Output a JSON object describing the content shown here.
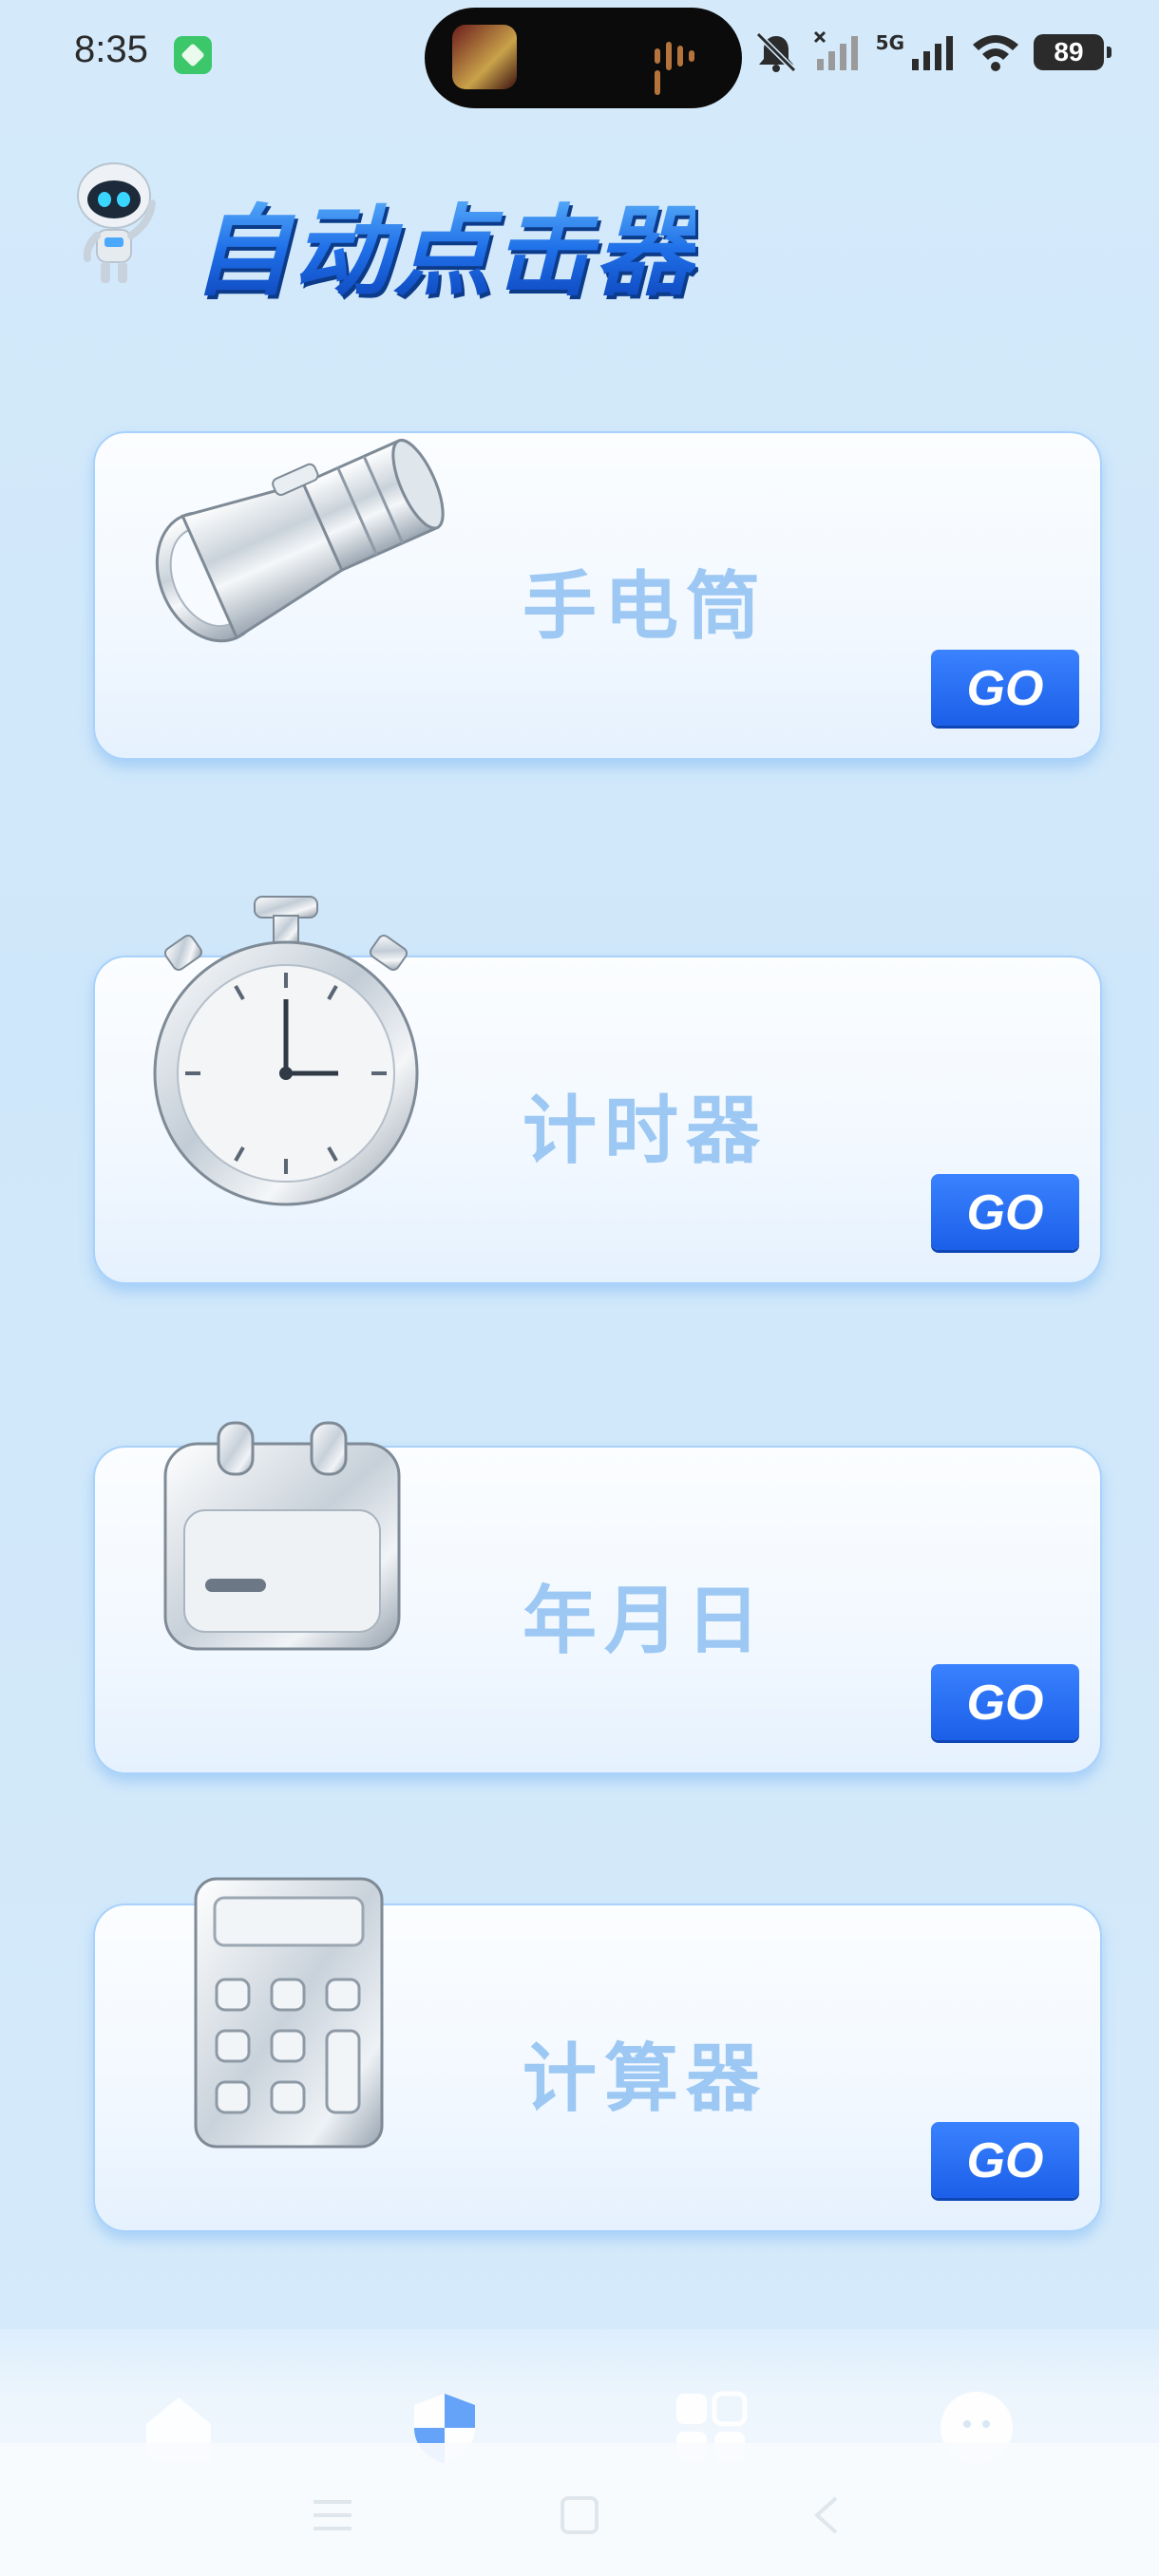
{
  "status_bar": {
    "time": "8:35",
    "network_label": "5G",
    "battery": "89"
  },
  "header": {
    "app_title": "自动点击器"
  },
  "cards": [
    {
      "title": "手电筒",
      "go_label": "GO",
      "icon": "flashlight-icon"
    },
    {
      "title": "计时器",
      "go_label": "GO",
      "icon": "stopwatch-icon"
    },
    {
      "title": "年月日",
      "go_label": "GO",
      "icon": "calendar-icon"
    },
    {
      "title": "计算器",
      "go_label": "GO",
      "icon": "calculator-icon"
    }
  ],
  "bottom_nav": {
    "items": [
      "home-icon",
      "shield-icon",
      "apps-icon",
      "face-icon"
    ]
  },
  "system_nav": [
    "menu-icon",
    "home-square-icon",
    "back-icon"
  ],
  "colors": {
    "accent": "#1b5fe8",
    "card_title": "#9cc8f3",
    "background": "#d4eafb"
  }
}
